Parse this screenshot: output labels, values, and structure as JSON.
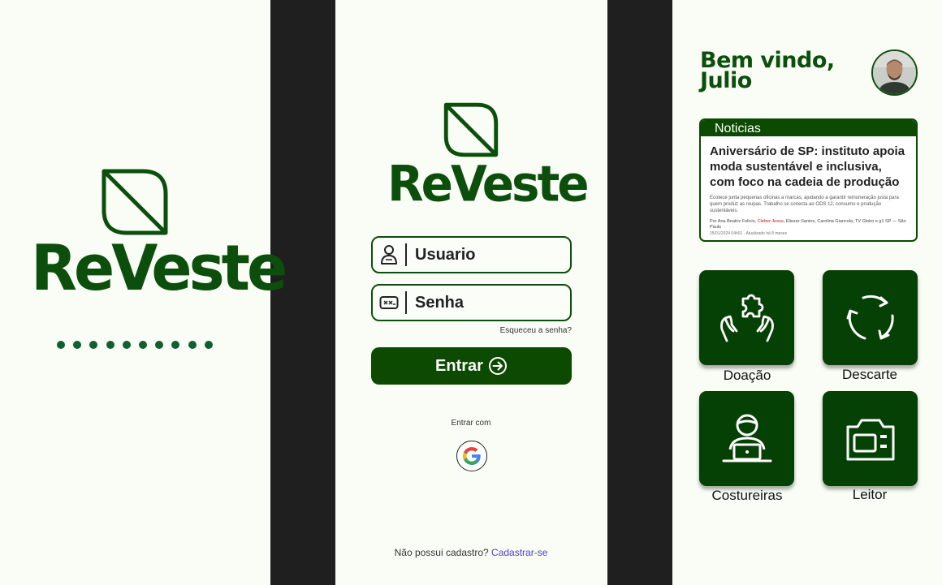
{
  "splash": {
    "brand": "ReVeste",
    "dot_count": 10
  },
  "login": {
    "brand": "ReVeste",
    "username_placeholder": "Usuario",
    "password_placeholder": "Senha",
    "forgot_label": "Esqueceu a senha?",
    "enter_label": "Entrar",
    "enter_with_label": "Entrar com",
    "no_account_label": "Não possui cadastro?",
    "signup_link": "Cadastrar-se"
  },
  "home": {
    "greeting_line1": "Bem vindo,",
    "greeting_line2": "Julio",
    "news": {
      "header": "Noticias",
      "title": "Aniversário de SP: instituto apoia moda sustentável e inclusiva, com foco na cadeia de produção",
      "summary": "Ecotece junta pequenas oficinas a marcas, ajudando a garantir remuneração justa para quem produz as roupas. Trabalho se conecta ao ODS 12, consumo e produção sustentáveis.",
      "byline_prefix": "Por Ana Beatriz Felicio,",
      "byline_highlight": "Cleber Jesus",
      "byline_suffix": ", Eliezer Santos, Carolina Giancola, TV Globo e g1 SP — São Paulo",
      "date": "25/01/2024 04h01 · Atualizado há 8 meses"
    },
    "tiles": [
      {
        "label": "Doação",
        "icon": "donation-hands-icon"
      },
      {
        "label": "Descarte",
        "icon": "recycle-icon"
      },
      {
        "label": "Costureiras",
        "icon": "seamstress-laptop-icon"
      },
      {
        "label": "Leitor",
        "icon": "camera-icon"
      }
    ]
  },
  "colors": {
    "background": "#f9fdf5",
    "brand_green": "#0c4f0c",
    "tile_green": "#054004",
    "separator_dark": "#1f1f1f",
    "link_purple": "#4f3bd8"
  }
}
